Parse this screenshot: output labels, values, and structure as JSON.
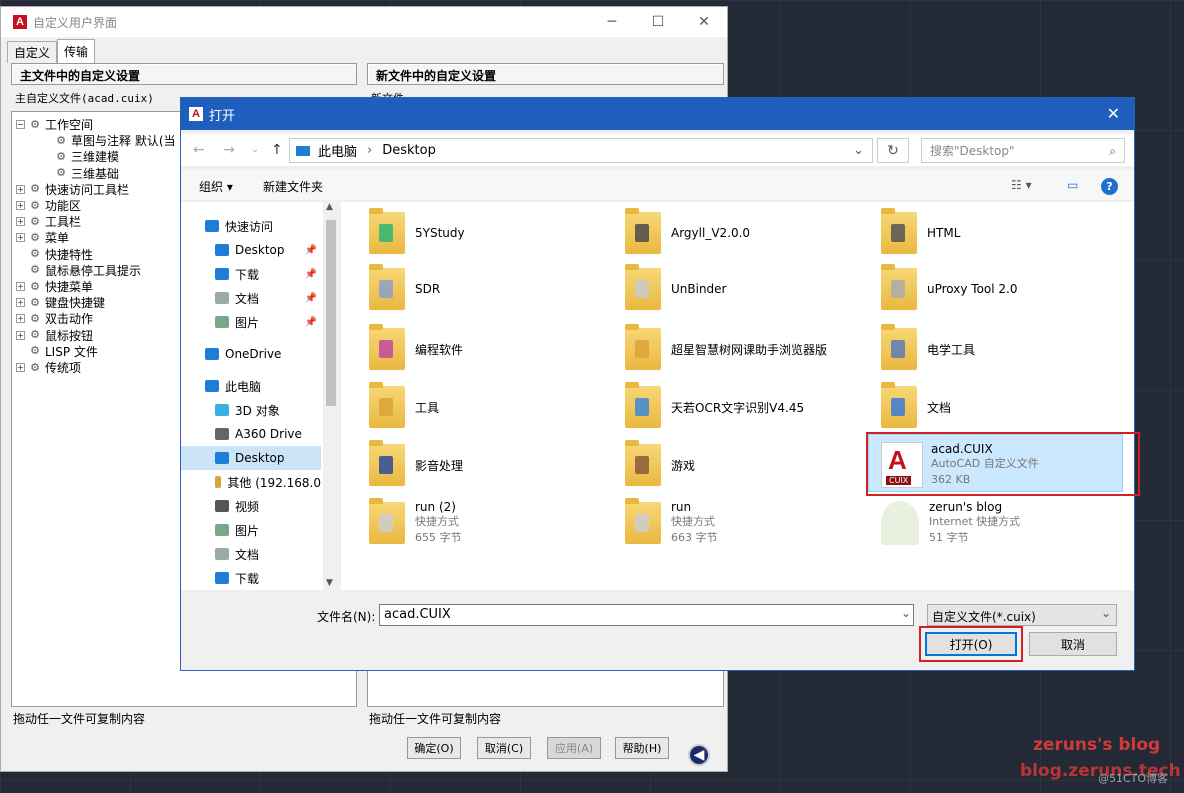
{
  "customize": {
    "title": "自定义用户界面",
    "tabs": [
      "自定义",
      "传输"
    ],
    "left_header": "主文件中的自定义设置",
    "right_header": "新文件中的自定义设置",
    "left_combo": "主自定义文件(acad.cuix)",
    "right_combo": "新文件",
    "tree": [
      {
        "label": "工作空间",
        "indent": 0,
        "pm": "⊟"
      },
      {
        "label": "草图与注释 默认(当",
        "indent": 1
      },
      {
        "label": "三维建模",
        "indent": 1
      },
      {
        "label": "三维基础",
        "indent": 1
      },
      {
        "label": "快速访问工具栏",
        "indent": 0,
        "pm": "⊞"
      },
      {
        "label": "功能区",
        "indent": 0,
        "pm": "⊞"
      },
      {
        "label": "工具栏",
        "indent": 0,
        "pm": "⊞"
      },
      {
        "label": "菜单",
        "indent": 0,
        "pm": "⊞"
      },
      {
        "label": "快捷特性",
        "indent": 0
      },
      {
        "label": "鼠标悬停工具提示",
        "indent": 0
      },
      {
        "label": "快捷菜单",
        "indent": 0,
        "pm": "⊞"
      },
      {
        "label": "键盘快捷键",
        "indent": 0,
        "pm": "⊞"
      },
      {
        "label": "双击动作",
        "indent": 0,
        "pm": "⊞"
      },
      {
        "label": "鼠标按钮",
        "indent": 0,
        "pm": "⊞"
      },
      {
        "label": "LISP 文件",
        "indent": 0
      },
      {
        "label": "传统项",
        "indent": 0,
        "pm": "⊞"
      }
    ],
    "status_left": "拖动任一文件可复制内容",
    "status_right": "拖动任一文件可复制内容",
    "buttons": {
      "ok": "确定(O)",
      "cancel": "取消(C)",
      "apply": "应用(A)",
      "help": "帮助(H)"
    }
  },
  "open": {
    "title": "打开",
    "breadcrumb": [
      "此电脑",
      "Desktop"
    ],
    "search_placeholder": "搜索\"Desktop\"",
    "toolbar": {
      "organize": "组织 ▾",
      "new_folder": "新建文件夹"
    },
    "nav": [
      {
        "label": "快速访问",
        "icon": "star-icon",
        "color": "#1e7ed6"
      },
      {
        "label": "Desktop",
        "icon": "desktop-icon",
        "color": "#1e7ed6",
        "pin": true
      },
      {
        "label": "下载",
        "icon": "download-icon",
        "color": "#1e7ed6",
        "pin": true
      },
      {
        "label": "文档",
        "icon": "document-icon",
        "color": "#9aa",
        "pin": true
      },
      {
        "label": "图片",
        "icon": "pictures-icon",
        "color": "#7a8",
        "pin": true
      },
      {
        "label": "OneDrive",
        "icon": "cloud-icon",
        "color": "#1e7ed6"
      },
      {
        "label": "此电脑",
        "icon": "computer-icon",
        "color": "#1e7ed6"
      },
      {
        "label": "3D 对象",
        "icon": "cube-icon",
        "color": "#3ab0e0"
      },
      {
        "label": "A360 Drive",
        "icon": "drive-icon",
        "color": "#666"
      },
      {
        "label": "Desktop",
        "icon": "desktop-icon",
        "color": "#1e7ed6",
        "selected": true
      },
      {
        "label": "其他 (192.168.0",
        "icon": "network-drive-icon",
        "color": "#d9a43a"
      },
      {
        "label": "视频",
        "icon": "video-icon",
        "color": "#555"
      },
      {
        "label": "图片",
        "icon": "pictures-icon",
        "color": "#7a8"
      },
      {
        "label": "文档",
        "icon": "document-icon",
        "color": "#9aa"
      },
      {
        "label": "下载",
        "icon": "download-icon",
        "color": "#1e7ed6"
      }
    ],
    "files": [
      {
        "name": "5YStudy",
        "col": 0,
        "row": 0,
        "accent": "#2bb673"
      },
      {
        "name": "Argyll_V2.0.0",
        "col": 1,
        "row": 0,
        "accent": "#4a4a4a"
      },
      {
        "name": "HTML",
        "col": 2,
        "row": 0,
        "accent": "#555"
      },
      {
        "name": "SDR",
        "col": 0,
        "row": 1,
        "accent": "#8aa0c8"
      },
      {
        "name": "UnBinder",
        "col": 1,
        "row": 1,
        "accent": "#c9c9c9"
      },
      {
        "name": "uProxy Tool 2.0",
        "col": 2,
        "row": 1,
        "accent": "#aaa"
      },
      {
        "name": "编程软件",
        "col": 0,
        "row": 2,
        "accent": "#c04aa0"
      },
      {
        "name": "超星智慧树网课助手浏览器版",
        "col": 1,
        "row": 2,
        "accent": "#d9a43a"
      },
      {
        "name": "电学工具",
        "col": 2,
        "row": 2,
        "accent": "#5a7ab8"
      },
      {
        "name": "工具",
        "col": 0,
        "row": 3,
        "accent": "#d9a43a"
      },
      {
        "name": "天若OCR文字识别V4.45",
        "col": 1,
        "row": 3,
        "accent": "#3a8ad8"
      },
      {
        "name": "文档",
        "col": 2,
        "row": 3,
        "accent": "#3a7ad8"
      },
      {
        "name": "影音处理",
        "col": 0,
        "row": 4,
        "accent": "#2a4a9a"
      },
      {
        "name": "游戏",
        "col": 1,
        "row": 4,
        "accent": "#8a5a3a"
      },
      {
        "name": "acad.CUIX",
        "sub1": "AutoCAD 自定义文件",
        "sub2": "362 KB",
        "col": 2,
        "row": 4,
        "type": "cuix"
      },
      {
        "name": "run (2)",
        "sub1": "快捷方式",
        "sub2": "655 字节",
        "col": 0,
        "row": 5,
        "type": "shortcut"
      },
      {
        "name": "run",
        "sub1": "快捷方式",
        "sub2": "663 字节",
        "col": 1,
        "row": 5,
        "type": "shortcut"
      },
      {
        "name": "zerun's blog",
        "sub1": "Internet 快捷方式",
        "sub2": "51 字节",
        "col": 2,
        "row": 5,
        "type": "web"
      }
    ],
    "filename_label": "文件名(N):",
    "filename_value": "acad.CUIX",
    "filter": "自定义文件(*.cuix)",
    "open_button": "打开(O)",
    "cancel_button": "取消"
  },
  "watermark": {
    "line1": "zeruns's blog",
    "line2": "blog.zeruns.tech",
    "site": "@51CTO博客"
  }
}
